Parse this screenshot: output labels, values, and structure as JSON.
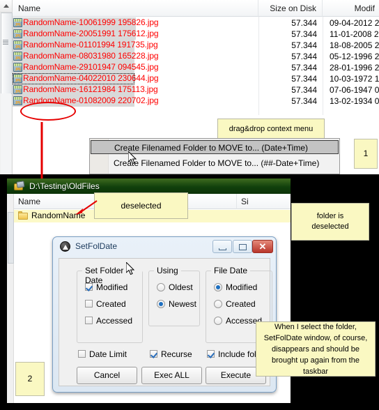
{
  "top_explorer": {
    "columns": [
      "Name",
      "Size on Disk",
      "Modif"
    ],
    "rows": [
      {
        "name": "RandomName-10061999 195826.jpg",
        "size": "57.344",
        "modified": "09-04-2012  2"
      },
      {
        "name": "RandomName-20051991 175612.jpg",
        "size": "57.344",
        "modified": "11-01-2008  2"
      },
      {
        "name": "RandomName-01101994 191735.jpg",
        "size": "57.344",
        "modified": "18-08-2005  2"
      },
      {
        "name": "RandomName-08031980 165228.jpg",
        "size": "57.344",
        "modified": "05-12-1996  2"
      },
      {
        "name": "RandomName-29101947 094545.jpg",
        "size": "57.344",
        "modified": "28-01-1996  2"
      },
      {
        "name": "RandomName-04022010 230644.jpg",
        "size": "57.344",
        "modified": "10-03-1972  1"
      },
      {
        "name": "RandomName-16121984 175113.jpg",
        "size": "57.344",
        "modified": "07-06-1947  0"
      },
      {
        "name": "RandomName-01082009 220702.jpg",
        "size": "57.344",
        "modified": "13-02-1934  0"
      }
    ],
    "file_icon": "jpg-file-icon",
    "file_text_color": "#ff0000"
  },
  "annotations": {
    "dragdrop_callout": "drag&drop context menu",
    "badge_1": "1",
    "badge_2": "2",
    "deselected_callout": "deselected",
    "folder_deselected_note_line1": "folder is",
    "folder_deselected_note_line2": "deselected",
    "big_note": "When I select the folder, SetFolDate window, of course, disappears and should be brought up again from the taskbar",
    "highlight_color": "#faf8c2",
    "arrow_color": "#e60000"
  },
  "context_menu": {
    "items": [
      {
        "label": "Create Filenamed Folder to MOVE to... (Date+Time)",
        "selected": true
      },
      {
        "label": "Create Filenamed Folder to MOVE to... (##-Date+Time)",
        "selected": false
      }
    ]
  },
  "bottom_explorer": {
    "title": "D:\\Testing\\OldFiles",
    "columns": [
      "Name",
      "Si"
    ],
    "rows": [
      {
        "name": "RandomName",
        "icon": "folder-icon"
      }
    ]
  },
  "dialog": {
    "title": "SetFolDate",
    "window_buttons": {
      "minimize": "minimize-button",
      "maximize": "maximize-button",
      "close": "close-button"
    },
    "groups": [
      {
        "legend": "Set Folder Date",
        "type": "checkbox",
        "options": [
          {
            "label": "Modified",
            "checked": true
          },
          {
            "label": "Created",
            "checked": false
          },
          {
            "label": "Accessed",
            "checked": false
          }
        ]
      },
      {
        "legend": "Using",
        "type": "radio",
        "options": [
          {
            "label": "Oldest",
            "checked": false
          },
          {
            "label": "Newest",
            "checked": true
          }
        ]
      },
      {
        "legend": "File Date",
        "type": "radio",
        "options": [
          {
            "label": "Modified",
            "checked": true
          },
          {
            "label": "Created",
            "checked": false
          },
          {
            "label": "Accessed",
            "checked": false
          }
        ]
      }
    ],
    "bottom_options": [
      {
        "label": "Date Limit",
        "checked": false
      },
      {
        "label": "Recurse",
        "checked": true
      },
      {
        "label": "Include folders",
        "checked": true
      }
    ],
    "buttons": [
      {
        "label": "Cancel"
      },
      {
        "label": "Exec ALL"
      },
      {
        "label": "Execute"
      }
    ]
  }
}
